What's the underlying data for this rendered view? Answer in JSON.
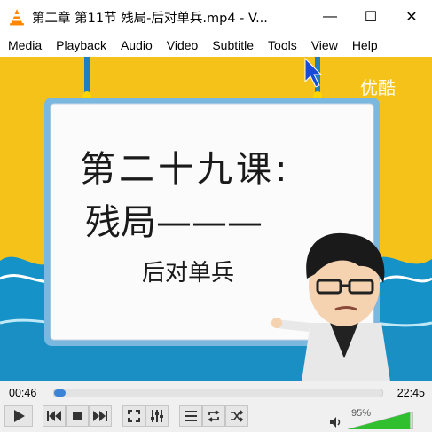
{
  "window": {
    "title": "第二章 第11节 残局-后对单兵.mp4 - V...",
    "app_icon": "vlc-cone-icon",
    "controls": {
      "minimize": "—",
      "maximize": "☐",
      "close": "✕"
    }
  },
  "menu": [
    "Media",
    "Playback",
    "Audio",
    "Video",
    "Subtitle",
    "Tools",
    "View",
    "Help"
  ],
  "video": {
    "watermark": "优酷",
    "board_title": "第二十九课:",
    "board_subtitle": "残局———",
    "board_caption": "后对单兵"
  },
  "playback": {
    "current_time": "00:46",
    "total_time": "22:45",
    "progress": 0.034
  },
  "volume": {
    "label": "95%",
    "level": 0.95
  },
  "colors": {
    "accent": "#3b83d7",
    "volume_green": "#2fbf2f",
    "background_yellow": "#f5c21a",
    "wave_blue": "#1593c8"
  },
  "buttons": {
    "play": "play-icon",
    "prev": "previous-icon",
    "stop": "stop-icon",
    "next": "next-icon",
    "fullscreen": "fullscreen-icon",
    "extended": "extended-settings-icon",
    "playlist": "playlist-icon",
    "loop": "loop-icon",
    "shuffle": "shuffle-icon"
  }
}
